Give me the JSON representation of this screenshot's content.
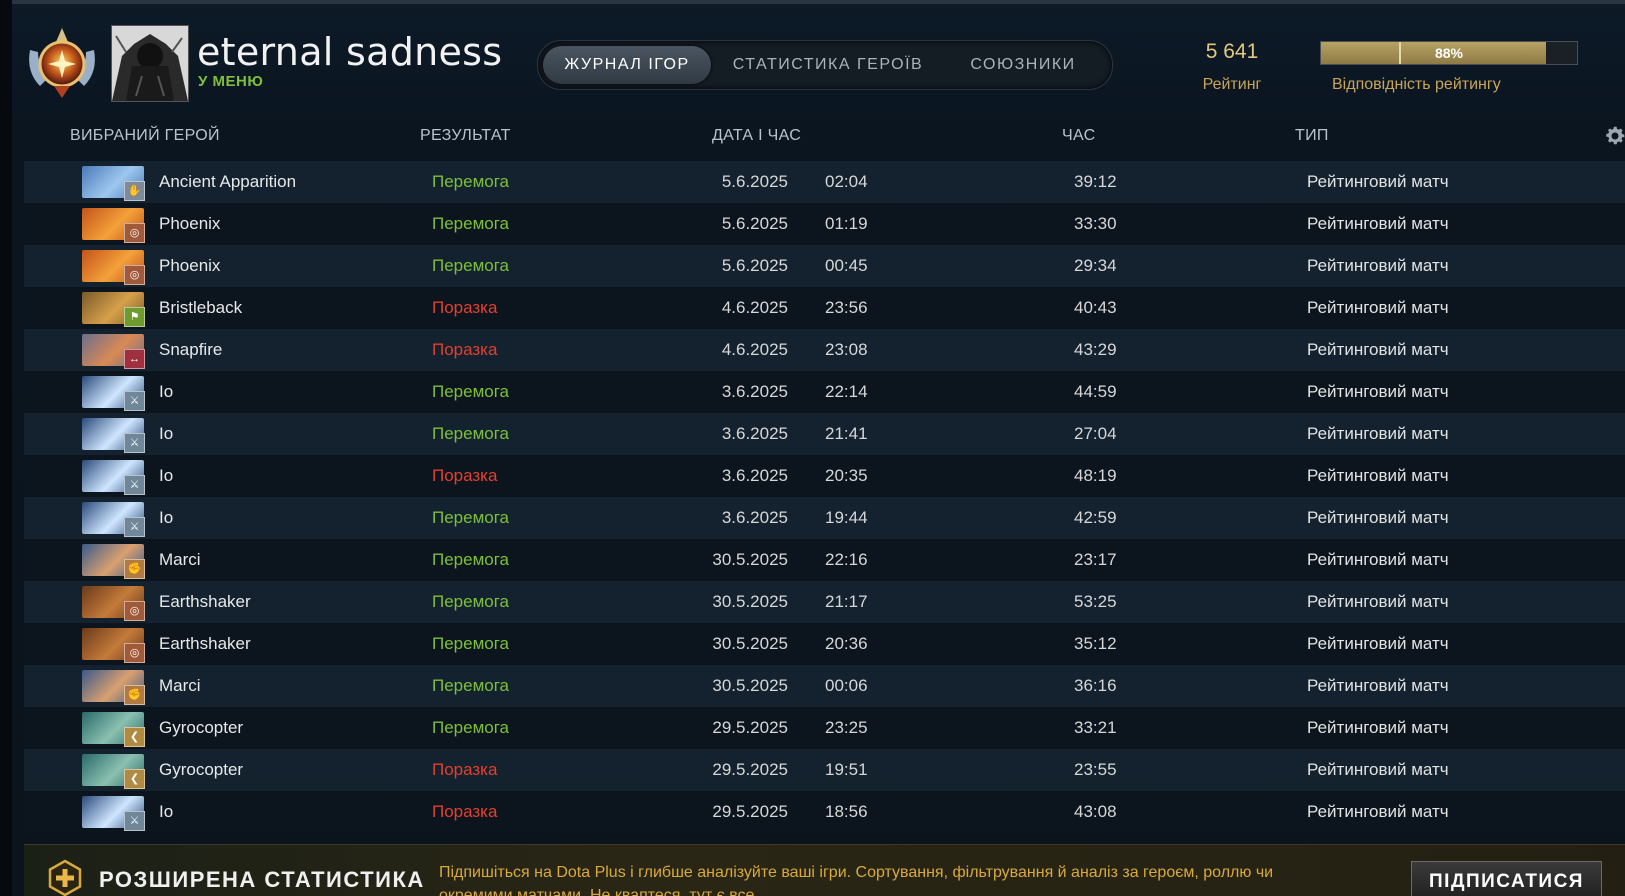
{
  "header": {
    "player_name": "eternal sadness",
    "status": "У МЕНЮ",
    "tabs": [
      {
        "label": "ЖУРНАЛ ІГОР",
        "active": true
      },
      {
        "label": "СТАТИСТИКА ГЕРОЇВ",
        "active": false
      },
      {
        "label": "СОЮЗНИКИ",
        "active": false
      }
    ],
    "rating_value": "5 641",
    "rating_label": "Рейтинг",
    "confidence_value": "88%",
    "confidence_fraction": 0.88,
    "confidence_label": "Відповідність рейтингу"
  },
  "table": {
    "columns": [
      "ВИБРАНИЙ ГЕРОЙ",
      "РЕЗУЛЬТАТ",
      "ДАТА І ЧАС",
      "ЧАС",
      "ТИП"
    ],
    "rows": [
      {
        "hero": "Ancient Apparition",
        "result": "Перемога",
        "outcome": "win",
        "date": "5.6.2025",
        "time": "02:04",
        "duration": "39:12",
        "type": "Рейтинговий матч",
        "portrait": [
          "#4a7ab8",
          "#9ec7ef"
        ],
        "role_color": "#7d8a99",
        "role_icon": "hand-icon",
        "role_glyph": "✋"
      },
      {
        "hero": "Phoenix",
        "result": "Перемога",
        "outcome": "win",
        "date": "5.6.2025",
        "time": "01:19",
        "duration": "33:30",
        "type": "Рейтинговий матч",
        "portrait": [
          "#c4531a",
          "#f3a13a"
        ],
        "role_color": "#a05a3a",
        "role_icon": "target-icon",
        "role_glyph": "◎"
      },
      {
        "hero": "Phoenix",
        "result": "Перемога",
        "outcome": "win",
        "date": "5.6.2025",
        "time": "00:45",
        "duration": "29:34",
        "type": "Рейтинговий матч",
        "portrait": [
          "#c4531a",
          "#f3a13a"
        ],
        "role_color": "#a05a3a",
        "role_icon": "target-icon",
        "role_glyph": "◎"
      },
      {
        "hero": "Bristleback",
        "result": "Поразка",
        "outcome": "loss",
        "date": "4.6.2025",
        "time": "23:56",
        "duration": "40:43",
        "type": "Рейтинговий матч",
        "portrait": [
          "#7a5a2a",
          "#d6a04a"
        ],
        "role_color": "#6f9a2e",
        "role_icon": "boot-icon",
        "role_glyph": "⚑"
      },
      {
        "hero": "Snapfire",
        "result": "Поразка",
        "outcome": "loss",
        "date": "4.6.2025",
        "time": "23:08",
        "duration": "43:29",
        "type": "Рейтинговий матч",
        "portrait": [
          "#6a6f8a",
          "#d98a55"
        ],
        "role_color": "#a0303f",
        "role_icon": "bow-icon",
        "role_glyph": "↔"
      },
      {
        "hero": "Io",
        "result": "Перемога",
        "outcome": "win",
        "date": "3.6.2025",
        "time": "22:14",
        "duration": "44:59",
        "type": "Рейтинговий матч",
        "portrait": [
          "#2a4a7a",
          "#cfe6ff"
        ],
        "role_color": "#6f8799",
        "role_icon": "sword-icon",
        "role_glyph": "⚔"
      },
      {
        "hero": "Io",
        "result": "Перемога",
        "outcome": "win",
        "date": "3.6.2025",
        "time": "21:41",
        "duration": "27:04",
        "type": "Рейтинговий матч",
        "portrait": [
          "#2a4a7a",
          "#cfe6ff"
        ],
        "role_color": "#6f8799",
        "role_icon": "sword-icon",
        "role_glyph": "⚔"
      },
      {
        "hero": "Io",
        "result": "Поразка",
        "outcome": "loss",
        "date": "3.6.2025",
        "time": "20:35",
        "duration": "48:19",
        "type": "Рейтинговий матч",
        "portrait": [
          "#2a4a7a",
          "#cfe6ff"
        ],
        "role_color": "#6f8799",
        "role_icon": "sword-icon",
        "role_glyph": "⚔"
      },
      {
        "hero": "Io",
        "result": "Перемога",
        "outcome": "win",
        "date": "3.6.2025",
        "time": "19:44",
        "duration": "42:59",
        "type": "Рейтинговий матч",
        "portrait": [
          "#2a4a7a",
          "#cfe6ff"
        ],
        "role_color": "#6f8799",
        "role_icon": "sword-icon",
        "role_glyph": "⚔"
      },
      {
        "hero": "Marci",
        "result": "Перемога",
        "outcome": "win",
        "date": "30.5.2025",
        "time": "22:16",
        "duration": "23:17",
        "type": "Рейтинговий матч",
        "portrait": [
          "#3a5a8a",
          "#d9a070"
        ],
        "role_color": "#b07a40",
        "role_icon": "fist-icon",
        "role_glyph": "✊"
      },
      {
        "hero": "Earthshaker",
        "result": "Перемога",
        "outcome": "win",
        "date": "30.5.2025",
        "time": "21:17",
        "duration": "53:25",
        "type": "Рейтинговий матч",
        "portrait": [
          "#6a3a1a",
          "#c47a3a"
        ],
        "role_color": "#a05a3a",
        "role_icon": "target-icon",
        "role_glyph": "◎"
      },
      {
        "hero": "Earthshaker",
        "result": "Перемога",
        "outcome": "win",
        "date": "30.5.2025",
        "time": "20:36",
        "duration": "35:12",
        "type": "Рейтинговий матч",
        "portrait": [
          "#6a3a1a",
          "#c47a3a"
        ],
        "role_color": "#a05a3a",
        "role_icon": "target-icon",
        "role_glyph": "◎"
      },
      {
        "hero": "Marci",
        "result": "Перемога",
        "outcome": "win",
        "date": "30.5.2025",
        "time": "00:06",
        "duration": "36:16",
        "type": "Рейтинговий матч",
        "portrait": [
          "#3a5a8a",
          "#d9a070"
        ],
        "role_color": "#b07a40",
        "role_icon": "fist-icon",
        "role_glyph": "✊"
      },
      {
        "hero": "Gyrocopter",
        "result": "Перемога",
        "outcome": "win",
        "date": "29.5.2025",
        "time": "23:25",
        "duration": "33:21",
        "type": "Рейтинговий матч",
        "portrait": [
          "#2a6a6a",
          "#8ac0b0"
        ],
        "role_color": "#b08a40",
        "role_icon": "wing-icon",
        "role_glyph": "❮"
      },
      {
        "hero": "Gyrocopter",
        "result": "Поразка",
        "outcome": "loss",
        "date": "29.5.2025",
        "time": "19:51",
        "duration": "23:55",
        "type": "Рейтинговий матч",
        "portrait": [
          "#2a6a6a",
          "#8ac0b0"
        ],
        "role_color": "#b08a40",
        "role_icon": "wing-icon",
        "role_glyph": "❮"
      },
      {
        "hero": "Io",
        "result": "Поразка",
        "outcome": "loss",
        "date": "29.5.2025",
        "time": "18:56",
        "duration": "43:08",
        "type": "Рейтинговий матч",
        "portrait": [
          "#2a4a7a",
          "#cfe6ff"
        ],
        "role_color": "#6f8799",
        "role_icon": "sword-icon",
        "role_glyph": "⚔"
      }
    ]
  },
  "footer": {
    "title": "РОЗШИРЕНА СТАТИСТИКА",
    "text": "Підпишіться на Dota Plus і глибше аналізуйте ваші ігри. Сортування, фільтрування й аналіз за героєм, роллю чи окремими матчами. Не кваптеся, тут є все.",
    "subscribe_label": "ПІДПИСАТИСЯ"
  }
}
